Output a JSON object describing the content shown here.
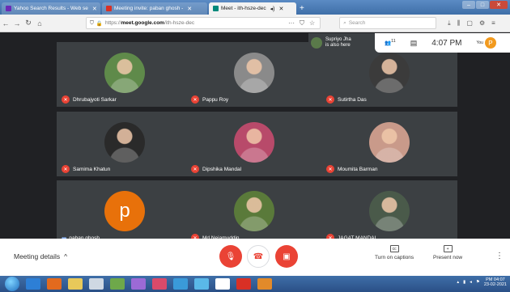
{
  "browser": {
    "tabs": [
      {
        "label": "Yahoo Search Results - Web se",
        "icon": "yahoo-icon",
        "color": "#6b2bb5"
      },
      {
        "label": "Meeting invite: paban ghosh - ",
        "icon": "gmail-icon",
        "color": "#d93025"
      },
      {
        "label": "Meet - ith-hsze-dec",
        "icon": "meet-icon",
        "color": "#00897b",
        "active": true
      }
    ],
    "url_prefix": "https://",
    "url_domain": "meet.google.com",
    "url_path": "/ith-hsze-dec",
    "search_placeholder": "Search",
    "more": "···"
  },
  "meet": {
    "notification": {
      "line1": "Supriyo Jha",
      "line2": "is also here"
    },
    "people_count": "11",
    "time": "4:07 PM",
    "you_label": "You",
    "you_initial": "P",
    "participants": [
      {
        "name": "Dhrubajyoti Sarkar",
        "muted": true,
        "photo": "#5f8a4a"
      },
      {
        "name": "Pappu Roy",
        "muted": true,
        "photo": "#8a8a8a"
      },
      {
        "name": "Sutirtha Das",
        "muted": true,
        "photo": "#3b3b3b"
      },
      {
        "name": "Samima Khatun",
        "muted": true,
        "photo": "#2a2a2a"
      },
      {
        "name": "Dipshika Mandal",
        "muted": true,
        "photo": "#b84a6a"
      },
      {
        "name": "Moumita Barman",
        "muted": true,
        "photo": "#c99a8a"
      },
      {
        "name": "paban ghosh",
        "muted": false,
        "initial": "p",
        "photo": "#e8710a"
      },
      {
        "name": "Md Nejamuddin",
        "muted": true,
        "photo": "#5a7a3a"
      },
      {
        "name": "JAGAT MANDAL",
        "muted": true,
        "photo": "#4a5a4a"
      }
    ],
    "controls": {
      "meeting_details": "Meeting details",
      "captions": "Turn on captions",
      "present": "Present now"
    }
  },
  "taskbar": {
    "time": "PM 04:07",
    "date": "23-02-2021"
  }
}
